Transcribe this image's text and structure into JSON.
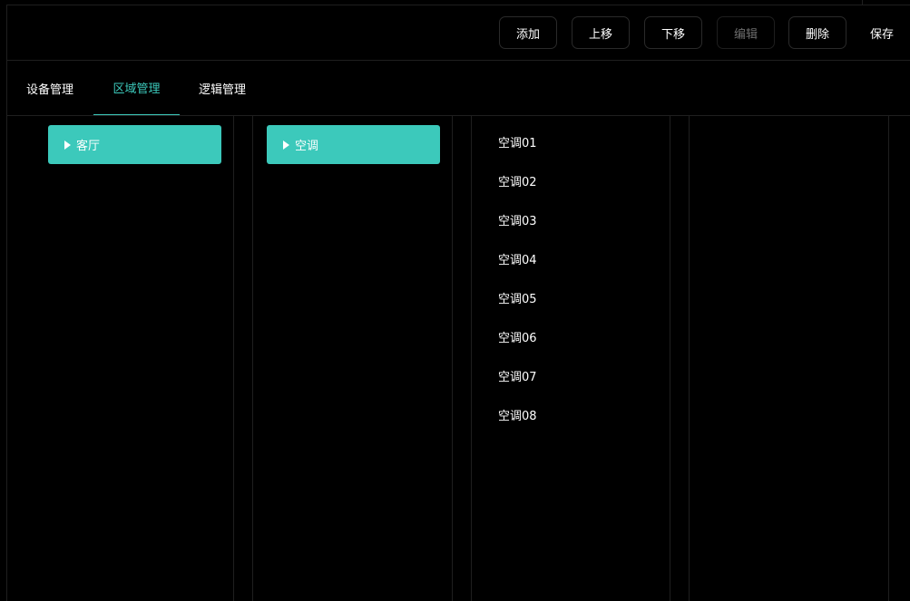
{
  "toolbar": {
    "add": "添加",
    "move_up": "上移",
    "move_down": "下移",
    "edit": "编辑",
    "delete": "删除",
    "save": "保存"
  },
  "tabs": [
    {
      "label": "设备管理",
      "active": false
    },
    {
      "label": "区域管理",
      "active": true
    },
    {
      "label": "逻辑管理",
      "active": false
    }
  ],
  "columns": {
    "area": {
      "selected": "客厅"
    },
    "category": {
      "selected": "空调"
    },
    "devices": [
      "空调01",
      "空调02",
      "空调03",
      "空调04",
      "空调05",
      "空调06",
      "空调07",
      "空调08"
    ]
  },
  "colors": {
    "accent": "#3cc9bb",
    "background": "#000000",
    "border": "#1f1f1f",
    "disabled_text": "#6d6d6d"
  }
}
